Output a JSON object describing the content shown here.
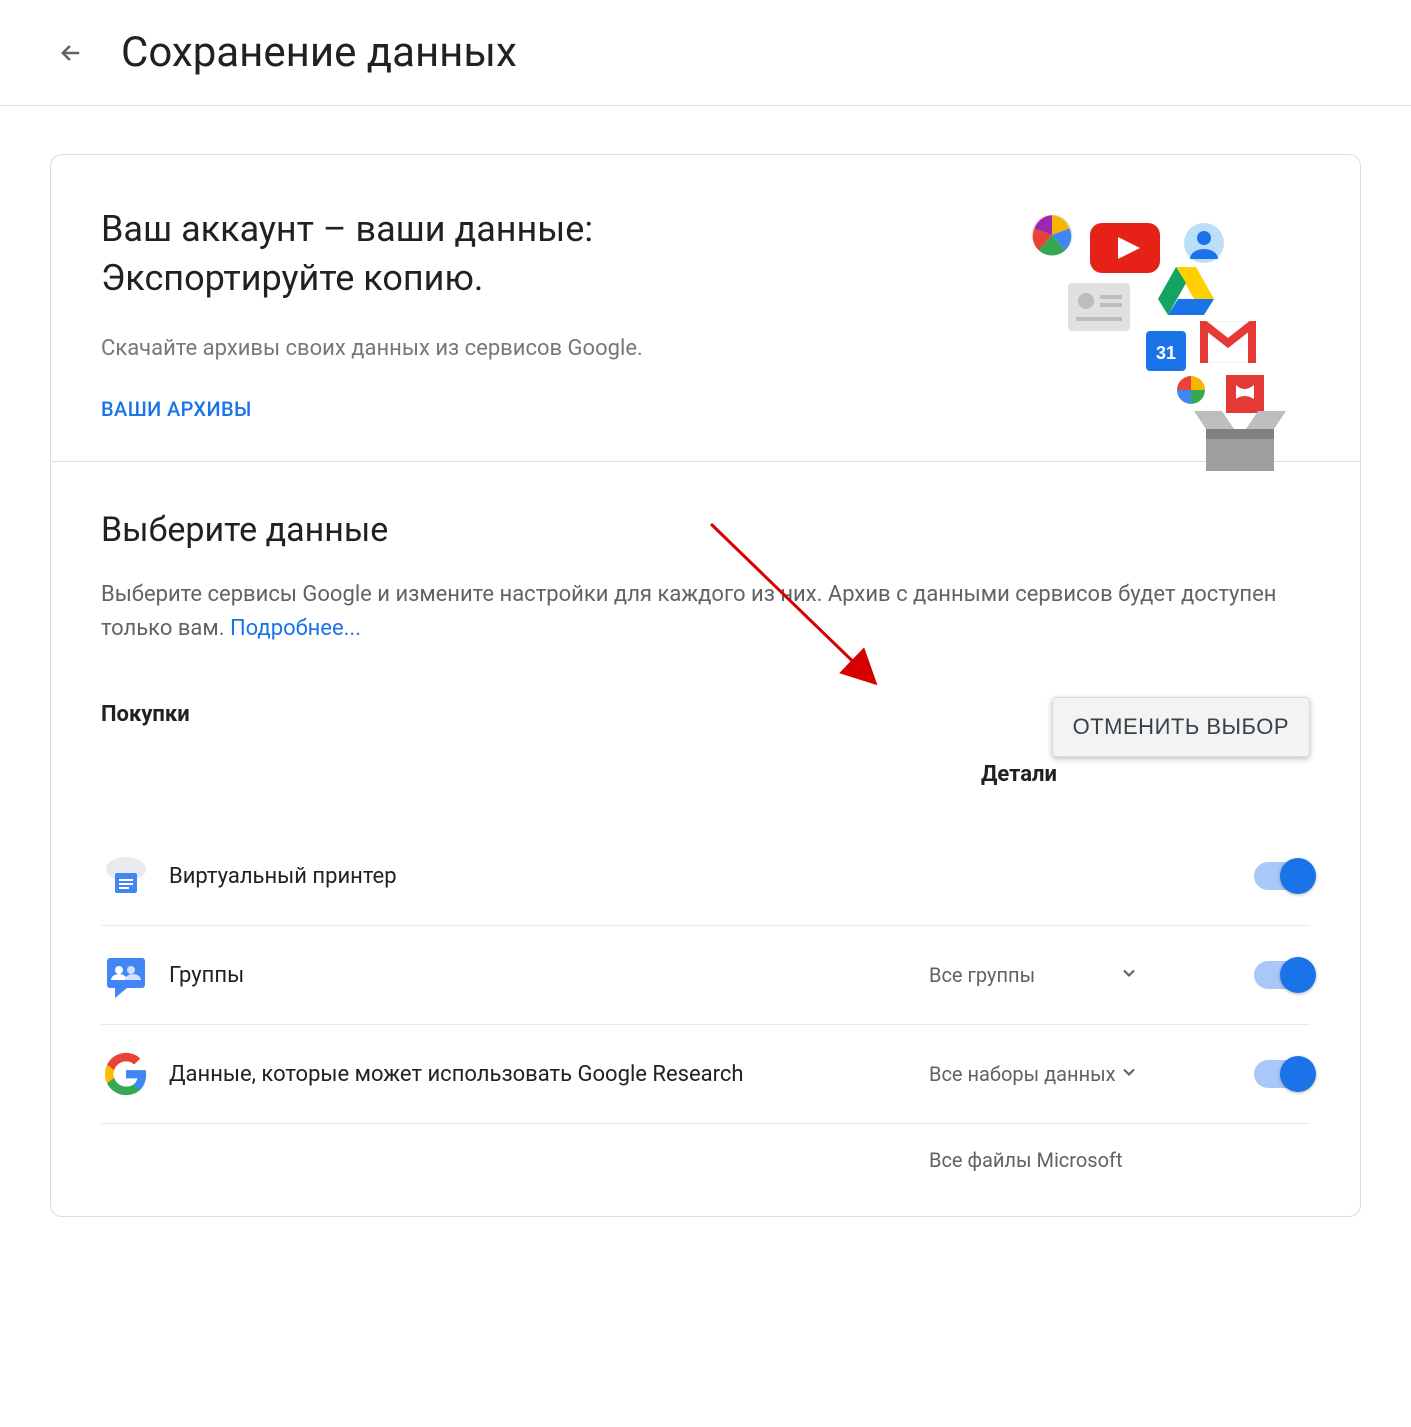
{
  "header": {
    "title": "Сохранение данных"
  },
  "intro": {
    "title_line1": "Ваш аккаунт – ваши данные:",
    "title_line2": "Экспортируйте копию.",
    "subtitle": "Скачайте архивы своих данных из сервисов Google.",
    "archives_link": "ВАШИ АРХИВЫ"
  },
  "select": {
    "title": "Выберите данные",
    "desc_before": "Выберите сервисы Google и измените настройки для каждого из них. Архив с данными сервисов будет доступен только вам. ",
    "more_link": "Подробнее...",
    "col_product": "Покупки",
    "col_details": "Детали",
    "deselect_button": "ОТМЕНИТЬ ВЫБОР"
  },
  "services": [
    {
      "name": "Виртуальный принтер",
      "detail": "",
      "has_detail": false,
      "checked": true
    },
    {
      "name": "Группы",
      "detail": "Все группы",
      "has_detail": true,
      "checked": true
    },
    {
      "name": "Данные, которые может использовать Google Research",
      "detail": "Все наборы данных",
      "has_detail": true,
      "checked": true
    },
    {
      "name": "",
      "detail": "Все файлы Microsoft",
      "has_detail": true,
      "checked": true
    }
  ]
}
